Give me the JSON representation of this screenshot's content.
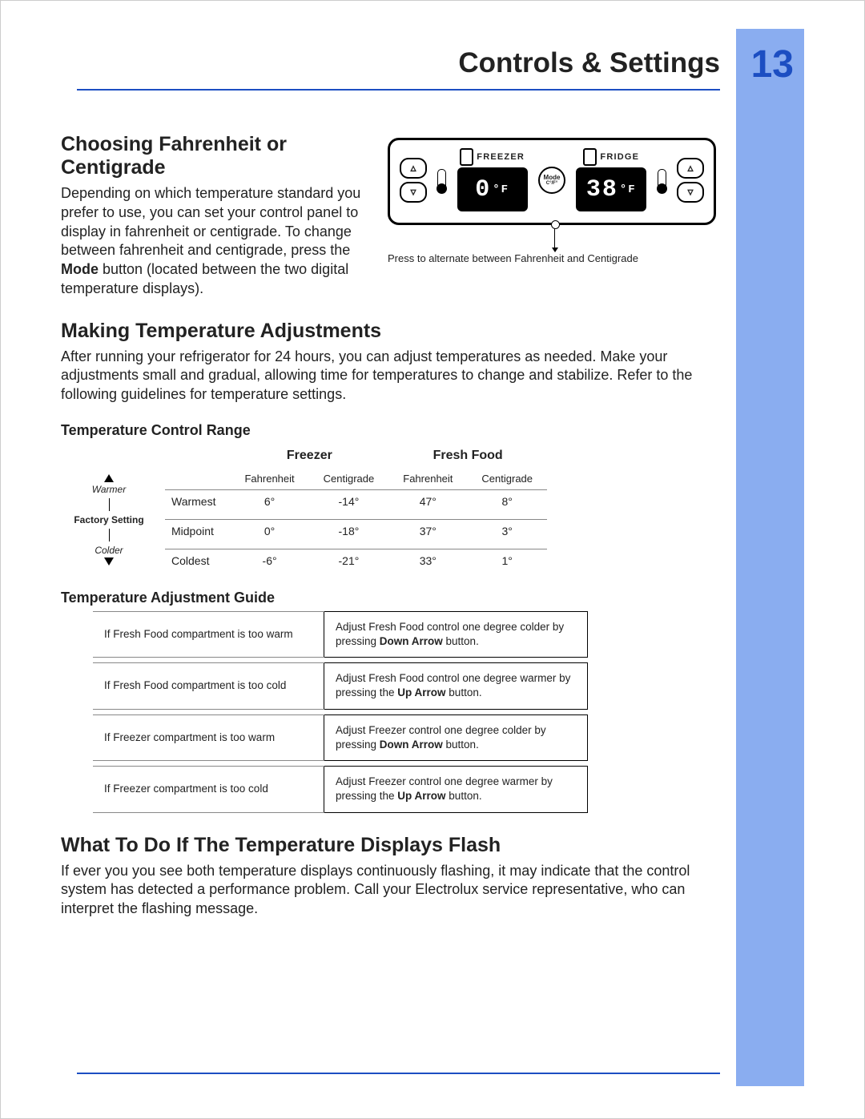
{
  "page": {
    "title": "Controls & Settings",
    "number": "13"
  },
  "section1": {
    "heading": "Choosing Fahrenheit or Centigrade",
    "body_a": "Depending on which temperature standard you prefer to use, you can set your control panel to display in fahrenheit or centigrade. To change between fahrenheit and centigrade, press the ",
    "body_bold": "Mode",
    "body_b": " button (located between the two digital temperature displays)."
  },
  "panel": {
    "freezer_label": "FREEZER",
    "fridge_label": "FRIDGE",
    "freezer_value": "0",
    "freezer_unit": "°F",
    "fridge_value": "38",
    "fridge_unit": "°F",
    "mode_top": "Mode",
    "mode_bottom": "C°/F°",
    "caption": "Press to alternate between Fahrenheit and Centigrade"
  },
  "section2": {
    "heading": "Making Temperature Adjustments",
    "body": "After running your refrigerator for 24 hours, you can adjust temperatures as needed. Make your adjustments small and gradual, allowing time for temperatures to change and stabilize. Refer to the following guidelines for temperature settings."
  },
  "range": {
    "title": "Temperature Control Range",
    "group1": "Freezer",
    "group2": "Fresh Food",
    "unit_f": "Fahrenheit",
    "unit_c": "Centigrade",
    "left_warmer": "Warmer",
    "left_factory": "Factory Setting",
    "left_colder": "Colder",
    "rows": [
      {
        "label": "Warmest",
        "ff": "6°",
        "fc": "-14°",
        "rf": "47°",
        "rc": "8°"
      },
      {
        "label": "Midpoint",
        "ff": "0°",
        "fc": "-18°",
        "rf": "37°",
        "rc": "3°"
      },
      {
        "label": "Coldest",
        "ff": "-6°",
        "fc": "-21°",
        "rf": "33°",
        "rc": "1°"
      }
    ]
  },
  "guide": {
    "title": "Temperature Adjustment Guide",
    "items": [
      {
        "condition": "If Fresh Food compartment is too warm",
        "action_a": "Adjust Fresh Food control one degree colder by pressing ",
        "action_bold": "Down Arrow",
        "action_b": " button."
      },
      {
        "condition": "If Fresh Food compartment is too cold",
        "action_a": "Adjust Fresh Food control one degree warmer by pressing the ",
        "action_bold": "Up Arrow",
        "action_b": " button."
      },
      {
        "condition": "If Freezer compartment is too warm",
        "action_a": "Adjust Freezer control one degree colder by pressing ",
        "action_bold": "Down Arrow",
        "action_b": " button."
      },
      {
        "condition": "If Freezer compartment is too cold",
        "action_a": "Adjust Freezer control one degree warmer by pressing the ",
        "action_bold": "Up Arrow",
        "action_b": " button."
      }
    ]
  },
  "section3": {
    "heading": "What To Do If The Temperature Displays Flash",
    "body": "If ever you you see both temperature displays continuously flashing, it may indicate that the control system has detected a performance problem. Call your Electrolux service representative, who can interpret the flashing message."
  }
}
